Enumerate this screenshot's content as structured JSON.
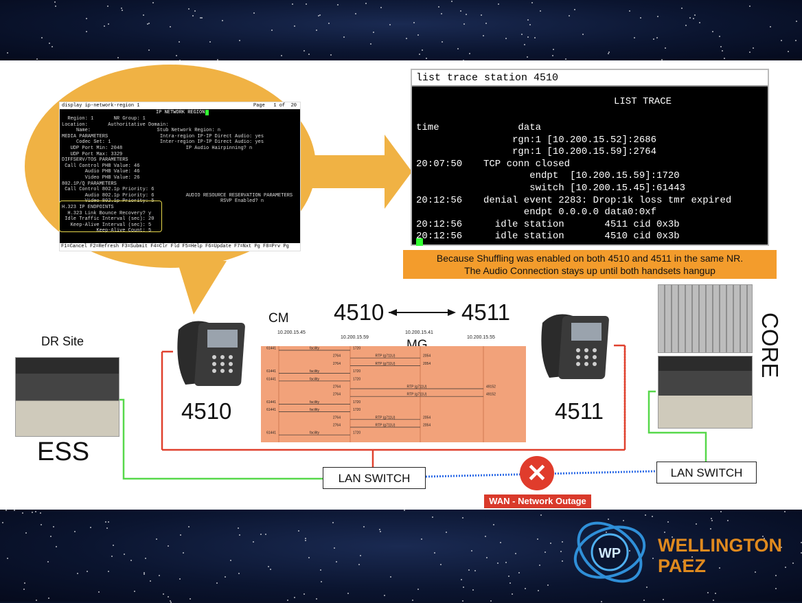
{
  "terminal_main": {
    "title": "list trace station 4510",
    "heading": "LIST TRACE",
    "lines": [
      {
        "time": "time",
        "text": "      data"
      },
      {
        "time": "",
        "text": "     rgn:1 [10.200.15.52]:2686"
      },
      {
        "time": "",
        "text": "     rgn:1 [10.200.15.59]:2764"
      },
      {
        "time": "20:07:50",
        "text": "TCP conn closed"
      },
      {
        "time": "",
        "text": "        endpt  [10.200.15.59]:1720"
      },
      {
        "time": "",
        "text": "        switch [10.200.15.45]:61443"
      },
      {
        "time": "20:12:56",
        "text": "denial event 2283: Drop:1k loss tmr expired"
      },
      {
        "time": "",
        "text": "       endpt 0.0.0.0 data0:0xf"
      },
      {
        "time": "20:12:56",
        "text": "  idle station       4511 cid 0x3b"
      },
      {
        "time": "20:12:56",
        "text": "  idle station       4510 cid 0x3b"
      }
    ]
  },
  "terminal_small": {
    "header_left": "display ip-network-region 1",
    "header_right": "Page   1 of  20",
    "title": "IP NETWORK REGION",
    "lines": [
      "  Region: 1       NR Group: 1",
      "Location:       Authoritative Domain:",
      "     Name:                       Stub Network Region: n",
      "MEDIA PARAMETERS                  Intra-region IP-IP Direct Audio: yes",
      "     Codec Set: 1                 Inter-region IP-IP Direct Audio: yes",
      "   UDP Port Min: 2048                      IP Audio Hairpinning? n",
      "   UDP Port Max: 3329",
      "DIFFSERV/TOS PARAMETERS",
      " Call Control PHB Value: 46",
      "        Audio PHB Value: 46",
      "        Video PHB Value: 26",
      "802.1P/Q PARAMETERS",
      " Call Control 802.1p Priority: 6",
      "        Audio 802.1p Priority: 6           AUDIO RESOURCE RESERVATION PARAMETERS",
      "        Video 802.1p Priority: 5                       RSVP Enabled? n",
      "H.323 IP ENDPOINTS",
      "  H.323 Link Bounce Recovery? y",
      " Idle Traffic Interval (sec): 20",
      "   Keep-Alive Interval (sec): 5",
      "            Keep-Alive Count: 5"
    ],
    "footer": "F1=Cancel F2=Refresh F3=Submit F4=Clr Fld F5=Help F6=Update F7=Nxt Pg F8=Prv Pg"
  },
  "note": {
    "line1": "Because Shuffling was enabled on both 4510 and 4511 in the same NR.",
    "line2": "The  Audio Connection stays up until both handsets hangup"
  },
  "labels": {
    "cm": "CM",
    "mg": "MG",
    "ext_a": "4510",
    "ext_b": "4511",
    "arrow": "⟵—⟶",
    "phone_a": "4510",
    "phone_b": "4511",
    "dr_site": "DR Site",
    "ess": "ESS",
    "core": "CORE",
    "lan_left": "LAN SWITCH",
    "lan_right": "LAN SWITCH",
    "wan": "WAN - Network Outage",
    "x": "✕"
  },
  "ladder": {
    "hosts": [
      "10.200.15.45",
      "10.200.15.59",
      "10.200.15.41",
      "10.200.15.55"
    ],
    "rows": [
      {
        "l": "61441",
        "m": "facility",
        "r": "1720"
      },
      {
        "l": "2764",
        "m": "RTP (g711U)",
        "r": "2054"
      },
      {
        "l": "2764",
        "m": "RTP (g711U)",
        "r": "2054"
      },
      {
        "l": "61441",
        "m": "facility",
        "r": "1720"
      },
      {
        "l": "61441",
        "m": "facility",
        "r": "1720"
      },
      {
        "l": "2764",
        "m": "RTP (g711U)",
        "r": "49152"
      },
      {
        "l": "2764",
        "m": "RTP (g711U)",
        "r": "49152"
      },
      {
        "l": "61441",
        "m": "facility",
        "r": "1720"
      },
      {
        "l": "61441",
        "m": "facility",
        "r": "1720"
      },
      {
        "l": "2764",
        "m": "RTP (g711U)",
        "r": "2054"
      },
      {
        "l": "2764",
        "m": "RTP (g711U)",
        "r": "2054"
      },
      {
        "l": "61441",
        "m": "facility",
        "r": "1720"
      }
    ]
  },
  "logo": {
    "line1": "WELLINGTON",
    "line2": "PAEZ",
    "mark": "WP"
  },
  "colors": {
    "accent": "#f0b244",
    "trace_bg": "#f2a27a",
    "logo": "#e08a1e",
    "wan": "#d93a2b",
    "lan_green": "#57d84a",
    "link_red": "#e0412e",
    "wan_blue": "#2d6be6"
  }
}
